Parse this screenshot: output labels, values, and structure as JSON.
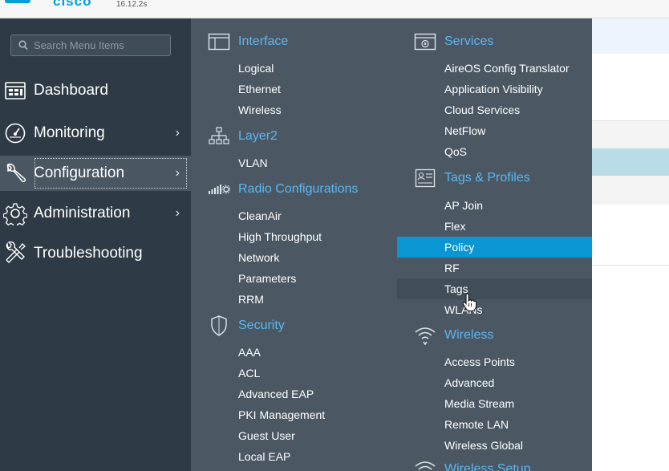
{
  "header": {
    "brand": "cisco",
    "version": "16.12.2s"
  },
  "search": {
    "placeholder": "Search Menu Items"
  },
  "nav": [
    {
      "label": "Dashboard"
    },
    {
      "label": "Monitoring"
    },
    {
      "label": "Configuration"
    },
    {
      "label": "Administration"
    },
    {
      "label": "Troubleshooting"
    }
  ],
  "menu": {
    "interface": {
      "title": "Interface",
      "items": [
        "Logical",
        "Ethernet",
        "Wireless"
      ]
    },
    "layer2": {
      "title": "Layer2",
      "items": [
        "VLAN"
      ]
    },
    "radio": {
      "title": "Radio Configurations",
      "items": [
        "CleanAir",
        "High Throughput",
        "Network",
        "Parameters",
        "RRM"
      ]
    },
    "security": {
      "title": "Security",
      "items": [
        "AAA",
        "ACL",
        "Advanced EAP",
        "PKI Management",
        "Guest User",
        "Local EAP"
      ]
    },
    "services": {
      "title": "Services",
      "items": [
        "AireOS Config Translator",
        "Application Visibility",
        "Cloud Services",
        "NetFlow",
        "QoS"
      ]
    },
    "tags": {
      "title": "Tags & Profiles",
      "items": [
        "AP Join",
        "Flex",
        "Policy",
        "RF",
        "Tags",
        "WLANs"
      ]
    },
    "wireless": {
      "title": "Wireless",
      "items": [
        "Access Points",
        "Advanced",
        "Media Stream",
        "Remote LAN",
        "Wireless Global"
      ]
    },
    "wireless_setup": {
      "title": "Wireless Setup"
    }
  },
  "colors": {
    "accent": "#5bb7f0",
    "highlight": "#0a96d3",
    "panel": "#4b5864",
    "sidebar": "#2e3b46"
  }
}
